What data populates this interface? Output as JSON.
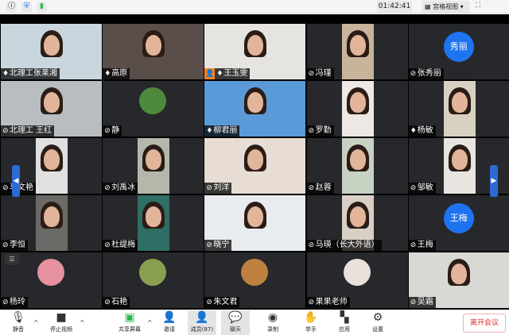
{
  "topbar": {
    "icons": [
      "info-icon",
      "shield-icon",
      "signal-icon"
    ],
    "timer": "01:42:41",
    "view_label": "宫格视图",
    "view_icon": "grid-icon"
  },
  "colors": {
    "accent": "#1e73f0",
    "host": "#f5821f",
    "leave": "#e02d2d",
    "active_speaker": "#2e9e4e"
  },
  "participants": [
    {
      "name": "北理工张莱湘",
      "muted": false,
      "type": "video",
      "bg": "#c9d6de",
      "active": true
    },
    {
      "name": "高原",
      "muted": false,
      "type": "video",
      "bg": "#5a4e4a"
    },
    {
      "name": "王玉雯",
      "muted": false,
      "type": "video",
      "bg": "#e6e4e0",
      "host": true
    },
    {
      "name": "冯瑾",
      "muted": true,
      "type": "video",
      "bg": "#c7b49a"
    },
    {
      "name": "张秀丽",
      "muted": true,
      "type": "avatar",
      "avatar_text": "秀丽"
    },
    {
      "name": "北理工 王红",
      "muted": true,
      "type": "video",
      "bg": "#b9bdbf"
    },
    {
      "name": "静",
      "muted": true,
      "type": "photo",
      "bg": "#4f8a3c"
    },
    {
      "name": "柳君丽",
      "muted": false,
      "type": "video",
      "bg": "#5a9ad8"
    },
    {
      "name": "罗勤",
      "muted": true,
      "type": "video",
      "bg": "#eee8e4"
    },
    {
      "name": "杨敏",
      "muted": false,
      "type": "video",
      "bg": "#d8d0c0"
    },
    {
      "name": "马文艳",
      "muted": true,
      "type": "video",
      "bg": "#e0e0e0"
    },
    {
      "name": "刘禹冰",
      "muted": true,
      "type": "video",
      "bg": "#b4b8aa"
    },
    {
      "name": "刘洋",
      "muted": true,
      "type": "video",
      "bg": "#e8ddd4"
    },
    {
      "name": "赵蓉",
      "muted": true,
      "type": "video",
      "bg": "#c8d2c2"
    },
    {
      "name": "邹敏",
      "muted": true,
      "type": "video",
      "bg": "#e8e4df"
    },
    {
      "name": "李恒",
      "muted": true,
      "type": "video",
      "bg": "#6c6a66"
    },
    {
      "name": "杜缇梅",
      "muted": true,
      "type": "video",
      "bg": "#2f6e64"
    },
    {
      "name": "晓宁",
      "muted": true,
      "type": "video",
      "bg": "#e9ecef"
    },
    {
      "name": "马瑛（长大外语）",
      "muted": true,
      "type": "video",
      "bg": "#d9cfc4"
    },
    {
      "name": "王梅",
      "muted": true,
      "type": "avatar",
      "avatar_text": "王梅"
    },
    {
      "name": "杨玲",
      "muted": true,
      "type": "photo",
      "bg": "#e690a0"
    },
    {
      "name": "石艳",
      "muted": true,
      "type": "photo",
      "bg": "#8aa050"
    },
    {
      "name": "朱文君",
      "muted": true,
      "type": "photo",
      "bg": "#c08040"
    },
    {
      "name": "果果老师",
      "muted": true,
      "type": "photo",
      "bg": "#e8e0da"
    },
    {
      "name": "吴霜",
      "muted": true,
      "type": "video",
      "bg": "#d8d8d4"
    }
  ],
  "toolbar": {
    "mute": "静音",
    "stop_video": "停止视频",
    "share_screen": "共享屏幕",
    "invite": "邀请",
    "participants": "成员(87)",
    "chat": "聊天",
    "record": "录制",
    "raise_hand": "举手",
    "apps": "应用",
    "settings": "设置",
    "leave": "离开会议"
  }
}
